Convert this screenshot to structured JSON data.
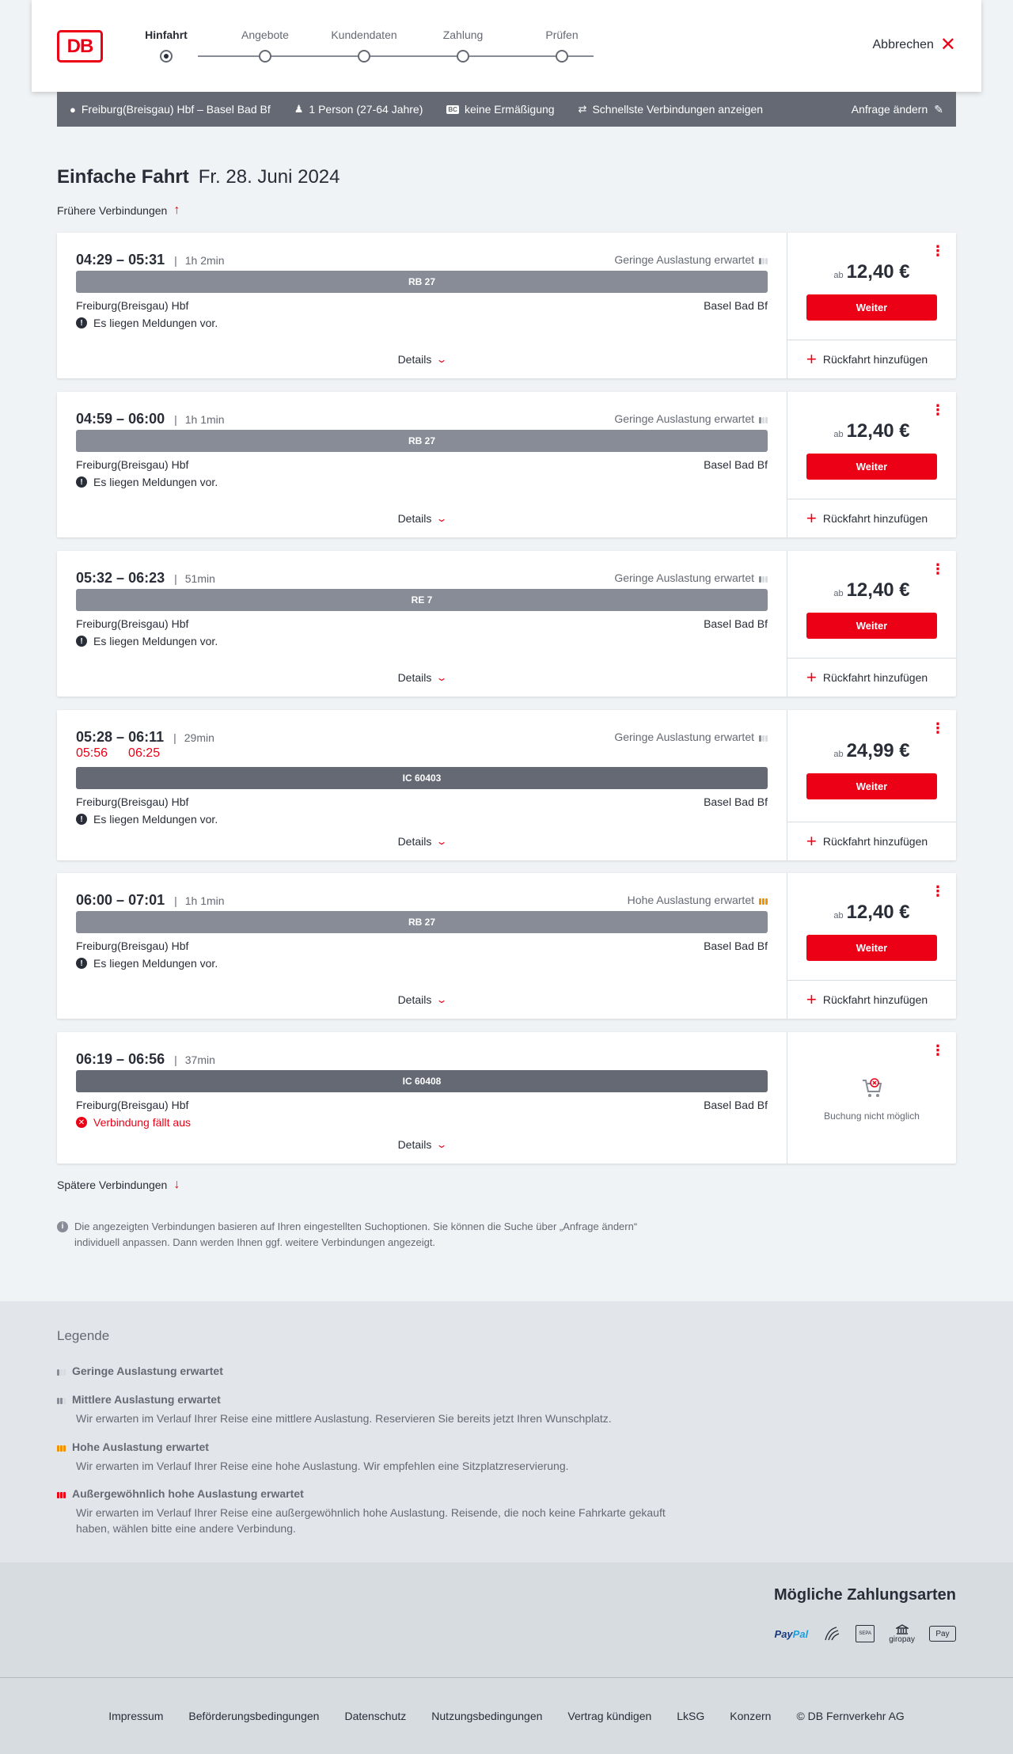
{
  "header": {
    "logo": "DB",
    "steps": [
      "Hinfahrt",
      "Angebote",
      "Kundendaten",
      "Zahlung",
      "Prüfen"
    ],
    "active_step": 0,
    "cancel_label": "Abbrechen"
  },
  "searchbar": {
    "route": "Freiburg(Breisgau) Hbf – Basel Bad Bf",
    "passengers": "1 Person (27-64 Jahre)",
    "discount_badge": "BC",
    "discount": "keine Ermäßigung",
    "fastest": "Schnellste Verbindungen anzeigen",
    "change": "Anfrage ändern"
  },
  "page": {
    "title_bold": "Einfache Fahrt",
    "title_date": "Fr. 28. Juni 2024",
    "earlier": "Frühere Verbindungen",
    "later": "Spätere Verbindungen"
  },
  "connections": [
    {
      "dep": "04:29",
      "arr": "05:31",
      "duration": "1h 2min",
      "load": "Geringe Auslastung erwartet",
      "load_level": 1,
      "load_color": "#878c96",
      "train": "RB 27",
      "train_type": "regional",
      "from": "Freiburg(Breisgau) Hbf",
      "to": "Basel Bad Bf",
      "notice": "Es liegen Meldungen vor.",
      "notice_type": "info",
      "details": "Details",
      "price_prefix": "ab",
      "price": "12,40 €",
      "button": "Weiter",
      "return": "Rückfahrt hinzufügen"
    },
    {
      "dep": "04:59",
      "arr": "06:00",
      "duration": "1h 1min",
      "load": "Geringe Auslastung erwartet",
      "load_level": 1,
      "load_color": "#878c96",
      "train": "RB 27",
      "train_type": "regional",
      "from": "Freiburg(Breisgau) Hbf",
      "to": "Basel Bad Bf",
      "notice": "Es liegen Meldungen vor.",
      "notice_type": "info",
      "details": "Details",
      "price_prefix": "ab",
      "price": "12,40 €",
      "button": "Weiter",
      "return": "Rückfahrt hinzufügen"
    },
    {
      "dep": "05:32",
      "arr": "06:23",
      "duration": "51min",
      "load": "Geringe Auslastung erwartet",
      "load_level": 1,
      "load_color": "#878c96",
      "train": "RE 7",
      "train_type": "regional",
      "from": "Freiburg(Breisgau) Hbf",
      "to": "Basel Bad Bf",
      "notice": "Es liegen Meldungen vor.",
      "notice_type": "info",
      "details": "Details",
      "price_prefix": "ab",
      "price": "12,40 €",
      "button": "Weiter",
      "return": "Rückfahrt hinzufügen"
    },
    {
      "dep": "05:28",
      "arr": "06:11",
      "duration": "29min",
      "dep_actual": "05:56",
      "arr_actual": "06:25",
      "load": "Geringe Auslastung erwartet",
      "load_level": 1,
      "load_color": "#878c96",
      "train": "IC 60403",
      "train_type": "ic",
      "from": "Freiburg(Breisgau) Hbf",
      "to": "Basel Bad Bf",
      "notice": "Es liegen Meldungen vor.",
      "notice_type": "info",
      "details": "Details",
      "price_prefix": "ab",
      "price": "24,99 €",
      "button": "Weiter",
      "return": "Rückfahrt hinzufügen"
    },
    {
      "dep": "06:00",
      "arr": "07:01",
      "duration": "1h 1min",
      "load": "Hohe Auslastung erwartet",
      "load_level": 3,
      "load_color": "#f39200",
      "train": "RB 27",
      "train_type": "regional",
      "from": "Freiburg(Breisgau) Hbf",
      "to": "Basel Bad Bf",
      "notice": "Es liegen Meldungen vor.",
      "notice_type": "info",
      "details": "Details",
      "price_prefix": "ab",
      "price": "12,40 €",
      "button": "Weiter",
      "return": "Rückfahrt hinzufügen"
    },
    {
      "dep": "06:19",
      "arr": "06:56",
      "duration": "37min",
      "train": "IC 60408",
      "train_type": "ic",
      "from": "Freiburg(Breisgau) Hbf",
      "to": "Basel Bad Bf",
      "notice": "Verbindung fällt aus",
      "notice_type": "cancelled",
      "details": "Details",
      "unavailable": "Buchung nicht möglich"
    }
  ],
  "info_note": "Die angezeigten Verbindungen basieren auf Ihren eingestellten Suchoptionen. Sie können die Suche über „Anfrage ändern“ individuell anpassen. Dann werden Ihnen ggf. weitere Verbindungen angezeigt.",
  "legend": {
    "title": "Legende",
    "items": [
      {
        "title": "Geringe Auslastung erwartet",
        "desc": ""
      },
      {
        "title": "Mittlere Auslastung erwartet",
        "desc": "Wir erwarten im Verlauf Ihrer Reise eine mittlere Auslastung. Reservieren Sie bereits jetzt Ihren Wunschplatz."
      },
      {
        "title": "Hohe Auslastung erwartet",
        "desc": "Wir erwarten im Verlauf Ihrer Reise eine hohe Auslastung. Wir empfehlen eine Sitzplatzreservierung."
      },
      {
        "title": "Außergewöhnlich hohe Auslastung erwartet",
        "desc": "Wir erwarten im Verlauf Ihrer Reise eine außergewöhnlich hohe Auslastung. Reisende, die noch keine Fahrkarte gekauft haben, wählen bitte eine andere Verbindung."
      }
    ]
  },
  "payment": {
    "title": "Mögliche Zahlungsarten",
    "methods": [
      "PayPal",
      "Kreditkarte",
      "SEPA",
      "giropay",
      "Apple Pay"
    ],
    "paypal_a": "Pay",
    "paypal_b": "Pal",
    "giropay": "giropay",
    "applepay": "Pay",
    "sepa": "SEPA"
  },
  "footer": {
    "links": [
      "Impressum",
      "Beförderungsbedingungen",
      "Datenschutz",
      "Nutzungsbedingungen",
      "Vertrag kündigen",
      "LkSG",
      "Konzern",
      "© DB Fernverkehr AG"
    ]
  },
  "colors": {
    "accent": "#ec0016",
    "text": "#282d37",
    "muted": "#646973"
  }
}
